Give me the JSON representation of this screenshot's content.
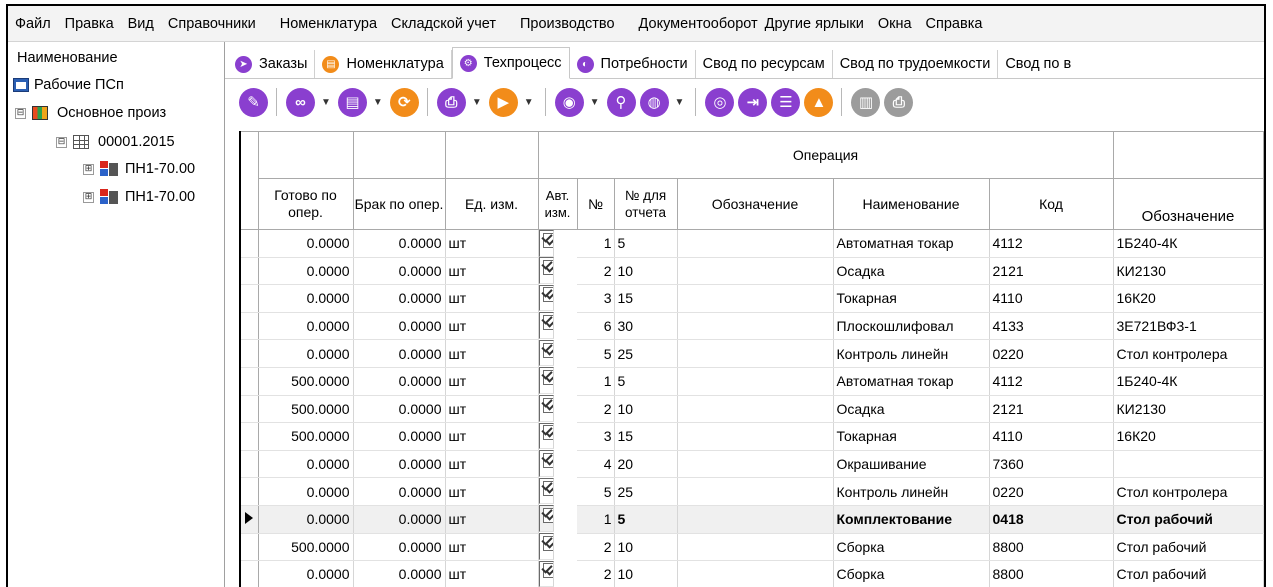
{
  "menu": [
    "Файл",
    "Правка",
    "Вид",
    "Справочники",
    "Номенклатура",
    "Складской учет",
    "Производство",
    "Документооборот",
    "Другие ярлыки",
    "Окна",
    "Справка"
  ],
  "tree": {
    "header": "Наименование",
    "nodes": [
      {
        "label": "Рабочие ПСп"
      },
      {
        "label": "Основное произ",
        "expander": "⊟"
      },
      {
        "label": "00001.2015",
        "expander": "⊟"
      },
      {
        "label": "ПН1-70.00",
        "expander": "⊞"
      },
      {
        "label": "ПН1-70.00",
        "expander": "⊞"
      }
    ]
  },
  "tabs": [
    {
      "label": "Заказы",
      "color": "#8a3fcf"
    },
    {
      "label": "Номенклатура",
      "color": "#f28c1a"
    },
    {
      "label": "Техпроцесс",
      "color": "#8a3fcf",
      "active": true
    },
    {
      "label": "Потребности",
      "color": "#8a3fcf"
    },
    {
      "label": "Свод по ресурсам"
    },
    {
      "label": "Свод по трудоемкости"
    },
    {
      "label": "Свод по в"
    }
  ],
  "toolbar_icons": [
    "edit-icon",
    "link-icon",
    "document-icon",
    "refresh-icon",
    "print-icon",
    "play-icon",
    "view-icon",
    "search-icon",
    "globe-icon",
    "disc-icon",
    "export-icon",
    "list-icon",
    "cone-icon",
    "card-icon",
    "printer-disabled-icon"
  ],
  "grid": {
    "group_header": "Операция",
    "headers": {
      "ready": "Готово по опер.",
      "defect": "Брак по опер.",
      "unit": "Ед. изм.",
      "auto": "Авт. изм.",
      "no": "№",
      "report_no": "№ для отчета",
      "designation": "Обозначение",
      "name": "Наименование",
      "code": "Код",
      "equip_designation": "Обозначение"
    },
    "rows": [
      {
        "ready": "0.0000",
        "defect": "0.0000",
        "unit": "шт",
        "no": "1",
        "report_no": "5",
        "designation": "",
        "name": "Автоматная токар",
        "code": "4112",
        "equip": "1Б240-4К"
      },
      {
        "ready": "0.0000",
        "defect": "0.0000",
        "unit": "шт",
        "no": "2",
        "report_no": "10",
        "designation": "",
        "name": "Осадка",
        "code": "2121",
        "equip": "КИ2130"
      },
      {
        "ready": "0.0000",
        "defect": "0.0000",
        "unit": "шт",
        "no": "3",
        "report_no": "15",
        "designation": "",
        "name": "Токарная",
        "code": "4110",
        "equip": "16К20"
      },
      {
        "ready": "0.0000",
        "defect": "0.0000",
        "unit": "шт",
        "no": "6",
        "report_no": "30",
        "designation": "",
        "name": "Плоскошлифовал",
        "code": "4133",
        "equip": "3Е721ВФ3-1"
      },
      {
        "ready": "0.0000",
        "defect": "0.0000",
        "unit": "шт",
        "no": "5",
        "report_no": "25",
        "designation": "",
        "name": "Контроль линейн",
        "code": "0220",
        "equip": "Стол контролера"
      },
      {
        "ready": "500.0000",
        "defect": "0.0000",
        "unit": "шт",
        "no": "1",
        "report_no": "5",
        "designation": "",
        "name": "Автоматная токар",
        "code": "4112",
        "equip": "1Б240-4К"
      },
      {
        "ready": "500.0000",
        "defect": "0.0000",
        "unit": "шт",
        "no": "2",
        "report_no": "10",
        "designation": "",
        "name": "Осадка",
        "code": "2121",
        "equip": "КИ2130"
      },
      {
        "ready": "500.0000",
        "defect": "0.0000",
        "unit": "шт",
        "no": "3",
        "report_no": "15",
        "designation": "",
        "name": "Токарная",
        "code": "4110",
        "equip": "16К20"
      },
      {
        "ready": "0.0000",
        "defect": "0.0000",
        "unit": "шт",
        "no": "4",
        "report_no": "20",
        "designation": "",
        "name": "Окрашивание",
        "code": "7360",
        "equip": ""
      },
      {
        "ready": "0.0000",
        "defect": "0.0000",
        "unit": "шт",
        "no": "5",
        "report_no": "25",
        "designation": "",
        "name": "Контроль линейн",
        "code": "0220",
        "equip": "Стол контролера"
      },
      {
        "ready": "0.0000",
        "defect": "0.0000",
        "unit": "шт",
        "no": "1",
        "report_no": "5",
        "designation": "",
        "name": "Комплектование",
        "code": "0418",
        "equip": "Стол рабочий",
        "current": true
      },
      {
        "ready": "500.0000",
        "defect": "0.0000",
        "unit": "шт",
        "no": "2",
        "report_no": "10",
        "designation": "",
        "name": "Сборка",
        "code": "8800",
        "equip": "Стол рабочий"
      },
      {
        "ready": "0.0000",
        "defect": "0.0000",
        "unit": "шт",
        "no": "2",
        "report_no": "10",
        "designation": "",
        "name": "Сборка",
        "code": "8800",
        "equip": "Стол рабочий"
      }
    ]
  }
}
